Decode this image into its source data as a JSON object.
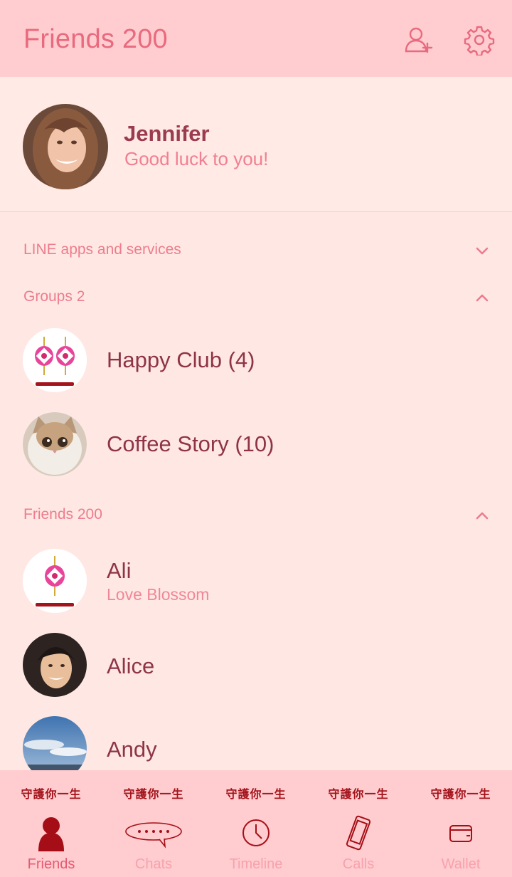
{
  "header": {
    "title": "Friends 200"
  },
  "profile": {
    "name": "Jennifer",
    "status": "Good luck to you!"
  },
  "sections": {
    "services": "LINE apps and services",
    "groups": "Groups 2",
    "friends": "Friends 200"
  },
  "groups": [
    {
      "name": "Happy Club (4)"
    },
    {
      "name": "Coffee Story (10)"
    }
  ],
  "friends": [
    {
      "name": "Ali",
      "status": "Love Blossom"
    },
    {
      "name": "Alice",
      "status": ""
    },
    {
      "name": "Andy",
      "status": ""
    }
  ],
  "tabs": [
    {
      "label": "Friends",
      "banner": "守護你一生",
      "icon": "person-icon",
      "active": true
    },
    {
      "label": "Chats",
      "banner": "守護你一生",
      "icon": "chat-bubble-icon"
    },
    {
      "label": "Timeline",
      "banner": "守護你一生",
      "icon": "clock-icon"
    },
    {
      "label": "Calls",
      "banner": "守護你一生",
      "icon": "phone-icon"
    },
    {
      "label": "Wallet",
      "banner": "守護你一生",
      "icon": "wallet-icon"
    }
  ],
  "colors": {
    "header_bg": "#ffcdd0",
    "page_bg": "#ffe8e3",
    "accent": "#e96a7e",
    "name_text": "#8e3446",
    "active_tab_icon": "#a50e16"
  }
}
